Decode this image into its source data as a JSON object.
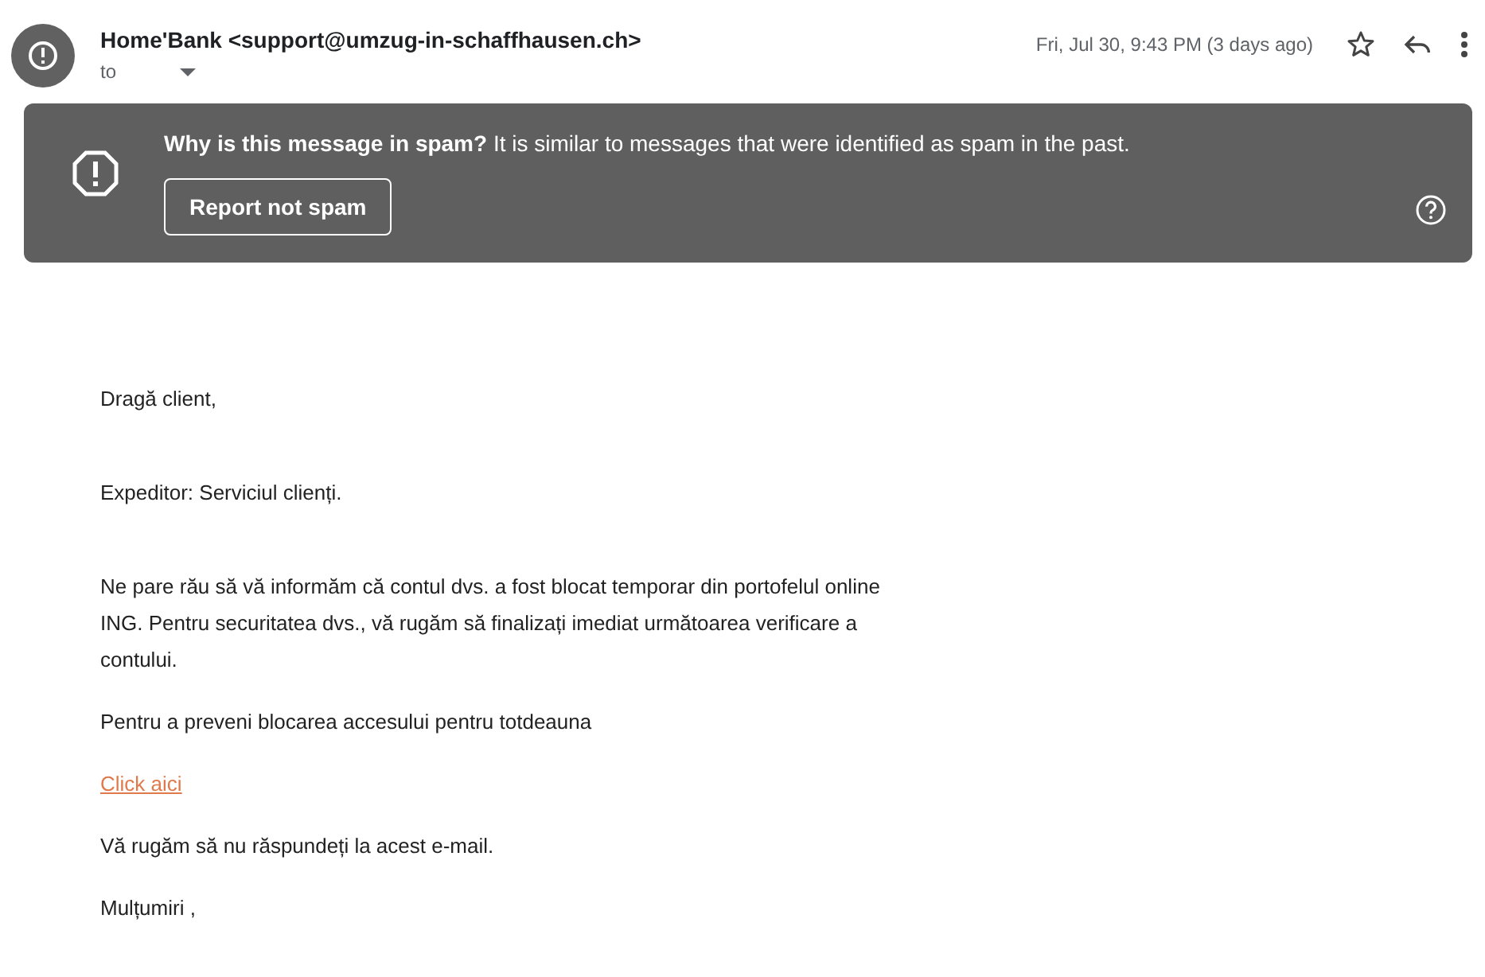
{
  "header": {
    "sender": "Home'Bank <support@umzug-in-schaffhausen.ch>",
    "to_label": "to",
    "date": "Fri, Jul 30, 9:43 PM (3 days ago)",
    "starred": false
  },
  "spam_banner": {
    "title": "Why is this message in spam?",
    "message": "It is similar to messages that were identified as spam in the past.",
    "button": "Report not spam"
  },
  "body": [
    {
      "kind": "text",
      "text": "Dragă client,"
    },
    {
      "kind": "text",
      "text": "Expeditor: Serviciul clienți."
    },
    {
      "kind": "text",
      "text": "Ne pare rău să vă informăm că contul dvs. a fost blocat temporar din portofelul online ING. Pentru securitatea dvs., vă rugăm să finalizați imediat următoarea verificare a contului."
    },
    {
      "kind": "text",
      "text": "Pentru a preveni blocarea accesului pentru totdeauna"
    },
    {
      "kind": "link",
      "text": "Click aici"
    },
    {
      "kind": "text",
      "text": "Vă rugăm să nu răspundeți la acest e-mail."
    },
    {
      "kind": "text",
      "text": "Mulțumiri ,"
    }
  ]
}
